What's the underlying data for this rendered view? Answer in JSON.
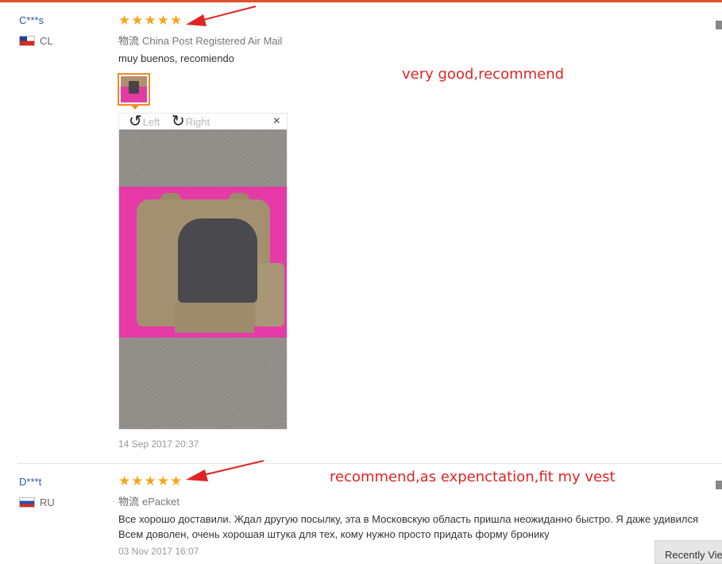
{
  "reviews": [
    {
      "user": "C***s",
      "country": "CL",
      "stars": "★★★★★",
      "logistics_label": "物流",
      "logistics_value": "China Post Registered Air Mail",
      "text": "muy buenos, recomiendo",
      "annotation": "very good,recommend",
      "time": "14 Sep 2017 20:37"
    },
    {
      "user": "D***t",
      "country": "RU",
      "stars": "★★★★★",
      "logistics_label": "物流",
      "logistics_value": "ePacket",
      "text_line1": "Все хорошо доставили. Ждал другую посылку, эта в Московскую область пришла неожиданно быстро. Я даже удивился",
      "text_line2": "Всем доволен, очень хорошая штука для тех, кому нужно просто придать форму бронику",
      "annotation": "recommend,as expenctation,fit my vest",
      "time": "03 Nov 2017 16:07"
    }
  ],
  "viewer": {
    "rotate_left": "Left",
    "rotate_right": "Right",
    "close": "×"
  },
  "recently_viewed": "Recently Viewed",
  "colors": {
    "accent": "#e0502a",
    "star": "#f7a51b",
    "annotation": "#e02424",
    "username": "#2a5a9e"
  },
  "icons": {
    "rotate_left": "rotate-left-icon",
    "rotate_right": "rotate-right-icon",
    "close": "close-icon",
    "arrow": "red-arrow-annotation"
  }
}
